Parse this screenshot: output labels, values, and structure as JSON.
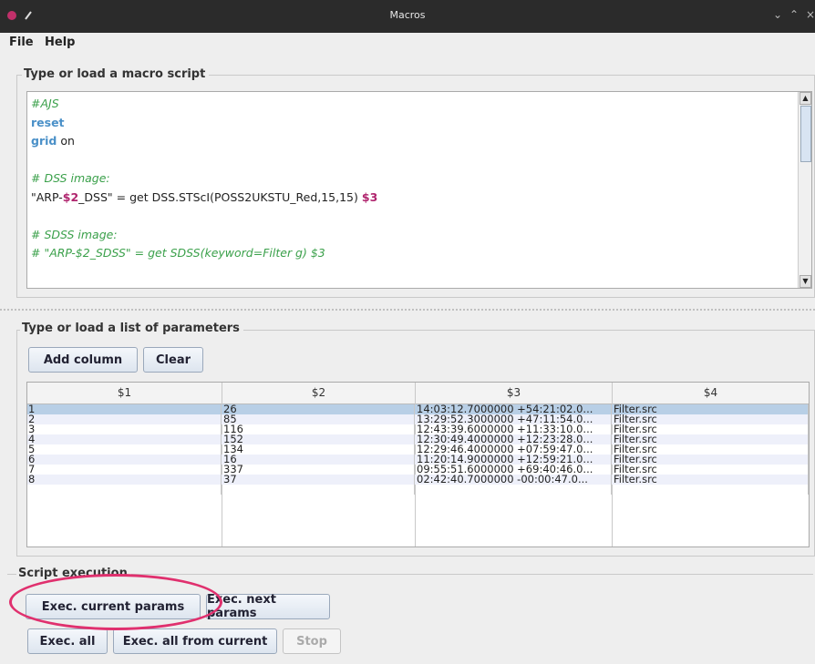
{
  "window": {
    "title": "Macros"
  },
  "menu": {
    "file": "File",
    "help": "Help"
  },
  "script_section": {
    "title": "Type or load a macro script",
    "lines": [
      {
        "parts": [
          {
            "t": "#AJS",
            "k": "comment"
          }
        ]
      },
      {
        "parts": [
          {
            "t": "reset",
            "k": "kw"
          }
        ]
      },
      {
        "parts": [
          {
            "t": "grid",
            "k": "kw"
          },
          {
            "t": " on",
            "k": "plain"
          }
        ]
      },
      {
        "parts": []
      },
      {
        "parts": [
          {
            "t": "# DSS image:",
            "k": "comment"
          }
        ]
      },
      {
        "parts": [
          {
            "t": "\"ARP-",
            "k": "plain"
          },
          {
            "t": "$2",
            "k": "var"
          },
          {
            "t": "_DSS\" = get DSS.STScI(POSS2UKSTU_Red,15,15) ",
            "k": "plain"
          },
          {
            "t": "$3",
            "k": "var"
          }
        ]
      },
      {
        "parts": []
      },
      {
        "parts": [
          {
            "t": "# SDSS image:",
            "k": "comment"
          }
        ]
      },
      {
        "parts": [
          {
            "t": "# \"ARP-$2_SDSS\" = get SDSS(keyword=Filter g) $3",
            "k": "comment"
          }
        ]
      }
    ]
  },
  "params_section": {
    "title": "Type or load a list of parameters",
    "add_column": "Add column",
    "clear": "Clear",
    "columns": [
      "$1",
      "$2",
      "$3",
      "$4"
    ],
    "rows": [
      [
        "1",
        "26",
        "14:03:12.7000000 +54:21:02.0...",
        "Filter.src"
      ],
      [
        "2",
        "85",
        "13:29:52.3000000 +47:11:54.0...",
        "Filter.src"
      ],
      [
        "3",
        "116",
        "12:43:39.6000000 +11:33:10.0...",
        "Filter.src"
      ],
      [
        "4",
        "152",
        "12:30:49.4000000 +12:23:28.0...",
        "Filter.src"
      ],
      [
        "5",
        "134",
        "12:29:46.4000000 +07:59:47.0...",
        "Filter.src"
      ],
      [
        "6",
        "16",
        "11:20:14.9000000 +12:59:21.0...",
        "Filter.src"
      ],
      [
        "7",
        "337",
        "09:55:51.6000000 +69:40:46.0...",
        "Filter.src"
      ],
      [
        "8",
        "37",
        "02:42:40.7000000 -00:00:47.0...",
        "Filter.src"
      ]
    ],
    "selected_row": 1
  },
  "execution_section": {
    "title": "Script execution",
    "exec_current": "Exec. current params",
    "exec_next": "Exec. next params",
    "exec_all": "Exec. all",
    "exec_all_from_current": "Exec. all from current",
    "stop": "Stop"
  },
  "colors": {
    "accent_highlight": "#e0306e",
    "row_selected": "#b8cfe6",
    "row_alt": "#eef0fa"
  }
}
